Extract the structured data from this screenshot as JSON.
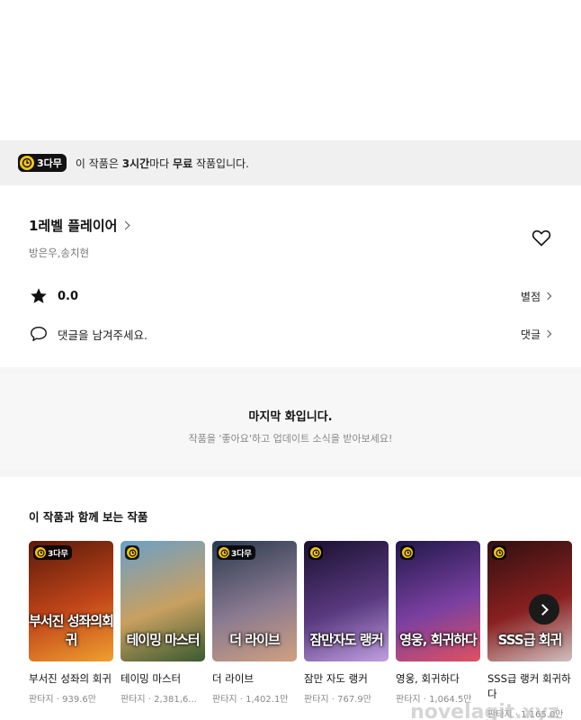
{
  "banner": {
    "badge": "3다무",
    "text_prefix": "이 작품은 ",
    "text_bold1": "3시간",
    "text_mid": "마다 ",
    "text_bold2": "무료",
    "text_suffix": " 작품입니다."
  },
  "work": {
    "title": "1레벨 플레이어",
    "authors": "방은우,송치현",
    "rating": "0.0",
    "rating_link": "별점",
    "comment_prompt": "댓글을 남겨주세요.",
    "comment_link": "댓글"
  },
  "end_notice": {
    "title": "마지막 화입니다.",
    "subtitle": "작품을 '좋아요'하고 업데이트 소식을 받아보세요!"
  },
  "related": {
    "title": "이 작품과 함께 보는 작품",
    "items": [
      {
        "name": "부서진 성좌의 회귀",
        "meta": "판타지 · 939.6만",
        "badge": "3다무",
        "cover_text": "부서진 성좌의회귀",
        "colors": [
          "#5a1a0a",
          "#c2461a",
          "#f0a030"
        ]
      },
      {
        "name": "테이밍 마스터",
        "meta": "판타지 · 2,381,6...",
        "badge": "",
        "cover_text": "테이밍 마스터",
        "colors": [
          "#6aa0c8",
          "#c8a060",
          "#3a5a30"
        ]
      },
      {
        "name": "더 라이브",
        "meta": "판타지 · 1,402.1만",
        "badge": "3다무",
        "cover_text": "더 라이브",
        "colors": [
          "#2a3a50",
          "#8a7a90",
          "#d0a080"
        ]
      },
      {
        "name": "잠만 자도 랭커",
        "meta": "판타지 · 767.9만",
        "badge": "",
        "cover_text": "잠만자도 랭커",
        "colors": [
          "#1a1030",
          "#5a3a80",
          "#c0a0e0"
        ]
      },
      {
        "name": "영웅, 회귀하다",
        "meta": "판타지 · 1,064.5만",
        "badge": "",
        "cover_text": "영웅, 회귀하다",
        "colors": [
          "#20184a",
          "#7a40a0",
          "#e05060"
        ]
      },
      {
        "name": "SSS급 랭커 회귀하다",
        "meta": "판타지 · 1,165.0만",
        "badge": "",
        "cover_text": "SSS급 회귀",
        "colors": [
          "#301010",
          "#8a2020",
          "#d0c0c0"
        ]
      }
    ]
  },
  "watermark": "novelagit.xyz"
}
